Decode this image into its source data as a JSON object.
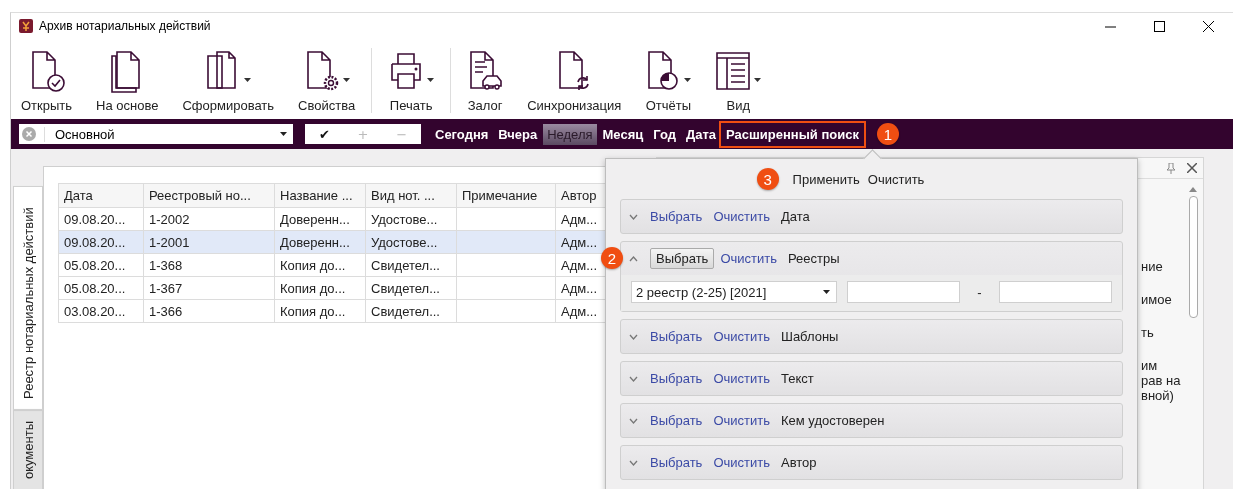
{
  "window": {
    "title": "Архив нотариальных действий"
  },
  "toolbar": [
    {
      "kind": "open",
      "label": "Открыть",
      "dropdown": false,
      "separator_before": false
    },
    {
      "kind": "copy",
      "label": "На основе",
      "dropdown": false,
      "separator_before": false
    },
    {
      "kind": "form",
      "label": "Сформировать",
      "dropdown": true,
      "separator_before": false
    },
    {
      "kind": "props",
      "label": "Свойства",
      "dropdown": true,
      "separator_before": false
    },
    {
      "kind": "print",
      "label": "Печать",
      "dropdown": true,
      "separator_before": true
    },
    {
      "kind": "pledge",
      "label": "Залог",
      "dropdown": false,
      "separator_before": true
    },
    {
      "kind": "sync",
      "label": "Синхронизация",
      "dropdown": false,
      "separator_before": false
    },
    {
      "kind": "reports",
      "label": "Отчёты",
      "dropdown": true,
      "separator_before": false
    },
    {
      "kind": "view",
      "label": "Вид",
      "dropdown": true,
      "separator_before": false
    }
  ],
  "filter_bar": {
    "preset": {
      "value": "Основной"
    },
    "preset_buttons": [
      {
        "label": "✔",
        "disabled": false
      },
      {
        "label": "+",
        "disabled": true
      },
      {
        "label": "−",
        "disabled": true
      }
    ],
    "periods": [
      {
        "label": "Сегодня",
        "selected": false
      },
      {
        "label": "Вчера",
        "selected": false
      },
      {
        "label": "Неделя",
        "selected": true
      },
      {
        "label": "Месяц",
        "selected": false
      },
      {
        "label": "Год",
        "selected": false
      },
      {
        "label": "Дата",
        "selected": false
      }
    ],
    "advanced_search": {
      "label": "Расширенный поиск",
      "callout": "1"
    }
  },
  "side_tabs": [
    {
      "label": "Реестр нотариальных действий",
      "selected": true
    },
    {
      "label": "окументы",
      "selected": false
    }
  ],
  "table": {
    "columns": [
      "Дата",
      "Реестровый но...",
      "Название ...",
      "Вид нот. ...",
      "Примечание",
      "Автор"
    ],
    "rows": [
      {
        "cells": [
          "09.08.20...",
          "1-2002",
          "Доверенн...",
          "Удостове...",
          "",
          "Адм..."
        ],
        "selected": false
      },
      {
        "cells": [
          "09.08.20...",
          "1-2001",
          "Доверенн...",
          "Удостове...",
          "",
          "Адм..."
        ],
        "selected": true
      },
      {
        "cells": [
          "05.08.20...",
          "1-368",
          "Копия до...",
          "Свидетел...",
          "",
          "Адм..."
        ],
        "selected": false
      },
      {
        "cells": [
          "05.08.20...",
          "1-367",
          "Копия до...",
          "Свидетел...",
          "",
          "Адм..."
        ],
        "selected": false
      },
      {
        "cells": [
          "03.08.20...",
          "1-366",
          "Копия до...",
          "Свидетел...",
          "",
          "Адм..."
        ],
        "selected": false
      }
    ]
  },
  "search_popup": {
    "apply": {
      "label": "Применить",
      "callout": "3"
    },
    "clear": {
      "label": "Очистить"
    },
    "sections": [
      {
        "title": "Дата",
        "select": "Выбрать",
        "clear": "Очистить",
        "expanded": false
      },
      {
        "title": "Реестры",
        "select": "Выбрать",
        "clear": "Очистить",
        "expanded": true,
        "select_callout": "2",
        "registry": {
          "value": "2 реестр (2-25) [2021]"
        },
        "range_separator": "-"
      },
      {
        "title": "Шаблоны",
        "select": "Выбрать",
        "clear": "Очистить",
        "expanded": false
      },
      {
        "title": "Текст",
        "select": "Выбрать",
        "clear": "Очистить",
        "expanded": false
      },
      {
        "title": "Кем удостоверен",
        "select": "Выбрать",
        "clear": "Очистить",
        "expanded": false
      },
      {
        "title": "Автор",
        "select": "Выбрать",
        "clear": "Очистить",
        "expanded": false
      }
    ]
  },
  "side_panel": {
    "fragments": [
      [
        "ние"
      ],
      [
        "имое"
      ],
      [
        "ть"
      ],
      [
        "им",
        "рав на",
        "вной)"
      ]
    ]
  }
}
